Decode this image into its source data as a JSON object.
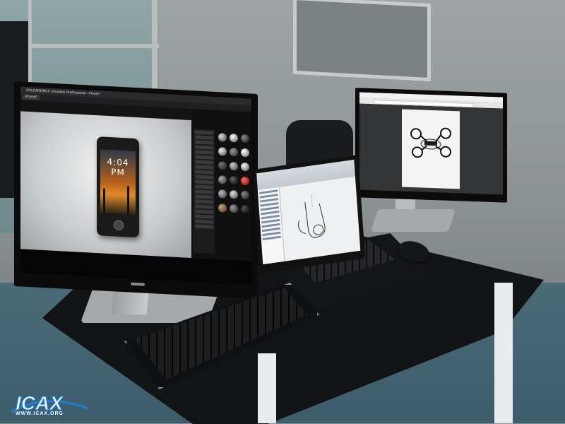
{
  "scene": {
    "colors": {
      "wall": "#9ea3a6",
      "floor": "#4b6a78",
      "desk": "#121314",
      "desk_legs": "#e8ecee",
      "accent_blue": "#1d7fd4"
    }
  },
  "left_monitor": {
    "window_title": "SOLIDWORKS Visualize Professional - Phone*",
    "tab_label": "Phone*",
    "phone_clock": "4:04 PM"
  },
  "laptop": {
    "app": "cad-sketch"
  },
  "right_monitor": {
    "browser_title": ""
  },
  "watermark": {
    "text": "WWW.ICAX.ORG",
    "logo": "ICAX-logo"
  }
}
